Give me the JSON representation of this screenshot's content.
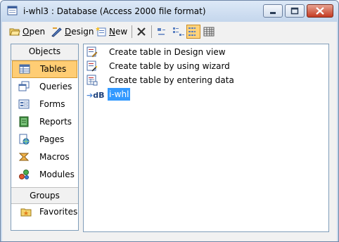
{
  "window": {
    "title": "i-whl3 : Database (Access 2000 file format)",
    "controls": {
      "minimize": "minimize",
      "maximize": "maximize",
      "close": "close"
    }
  },
  "toolbar": {
    "open_label": "Open",
    "open_accel": "O",
    "design_label": "Design",
    "design_accel": "D",
    "new_label": "New",
    "new_accel": "N",
    "icons": [
      "open-icon",
      "design-icon",
      "new-icon",
      "delete-icon",
      "large-icons-view-icon",
      "small-icons-view-icon",
      "list-view-icon",
      "details-view-icon"
    ]
  },
  "sidebar": {
    "objects_header": "Objects",
    "items": [
      {
        "label": "Tables",
        "icon": "table-icon",
        "active": true
      },
      {
        "label": "Queries",
        "icon": "query-icon",
        "active": false
      },
      {
        "label": "Forms",
        "icon": "form-icon",
        "active": false
      },
      {
        "label": "Reports",
        "icon": "report-icon",
        "active": false
      },
      {
        "label": "Pages",
        "icon": "page-icon",
        "active": false
      },
      {
        "label": "Macros",
        "icon": "macro-icon",
        "active": false
      },
      {
        "label": "Modules",
        "icon": "module-icon",
        "active": false
      }
    ],
    "groups_header": "Groups",
    "favorites_label": "Favorites"
  },
  "main": {
    "items": [
      {
        "label": "Create table in Design view",
        "icon": "create-design-icon"
      },
      {
        "label": "Create table by using wizard",
        "icon": "create-wizard-icon"
      },
      {
        "label": "Create table by entering data",
        "icon": "create-datasheet-icon"
      },
      {
        "label": "i-whl",
        "icon": "linked-table-icon",
        "selected": true,
        "icon_text": "dB"
      }
    ]
  },
  "colors": {
    "accent": "#ffcd74",
    "selection": "#3399ff",
    "frame": "#c9daee"
  }
}
